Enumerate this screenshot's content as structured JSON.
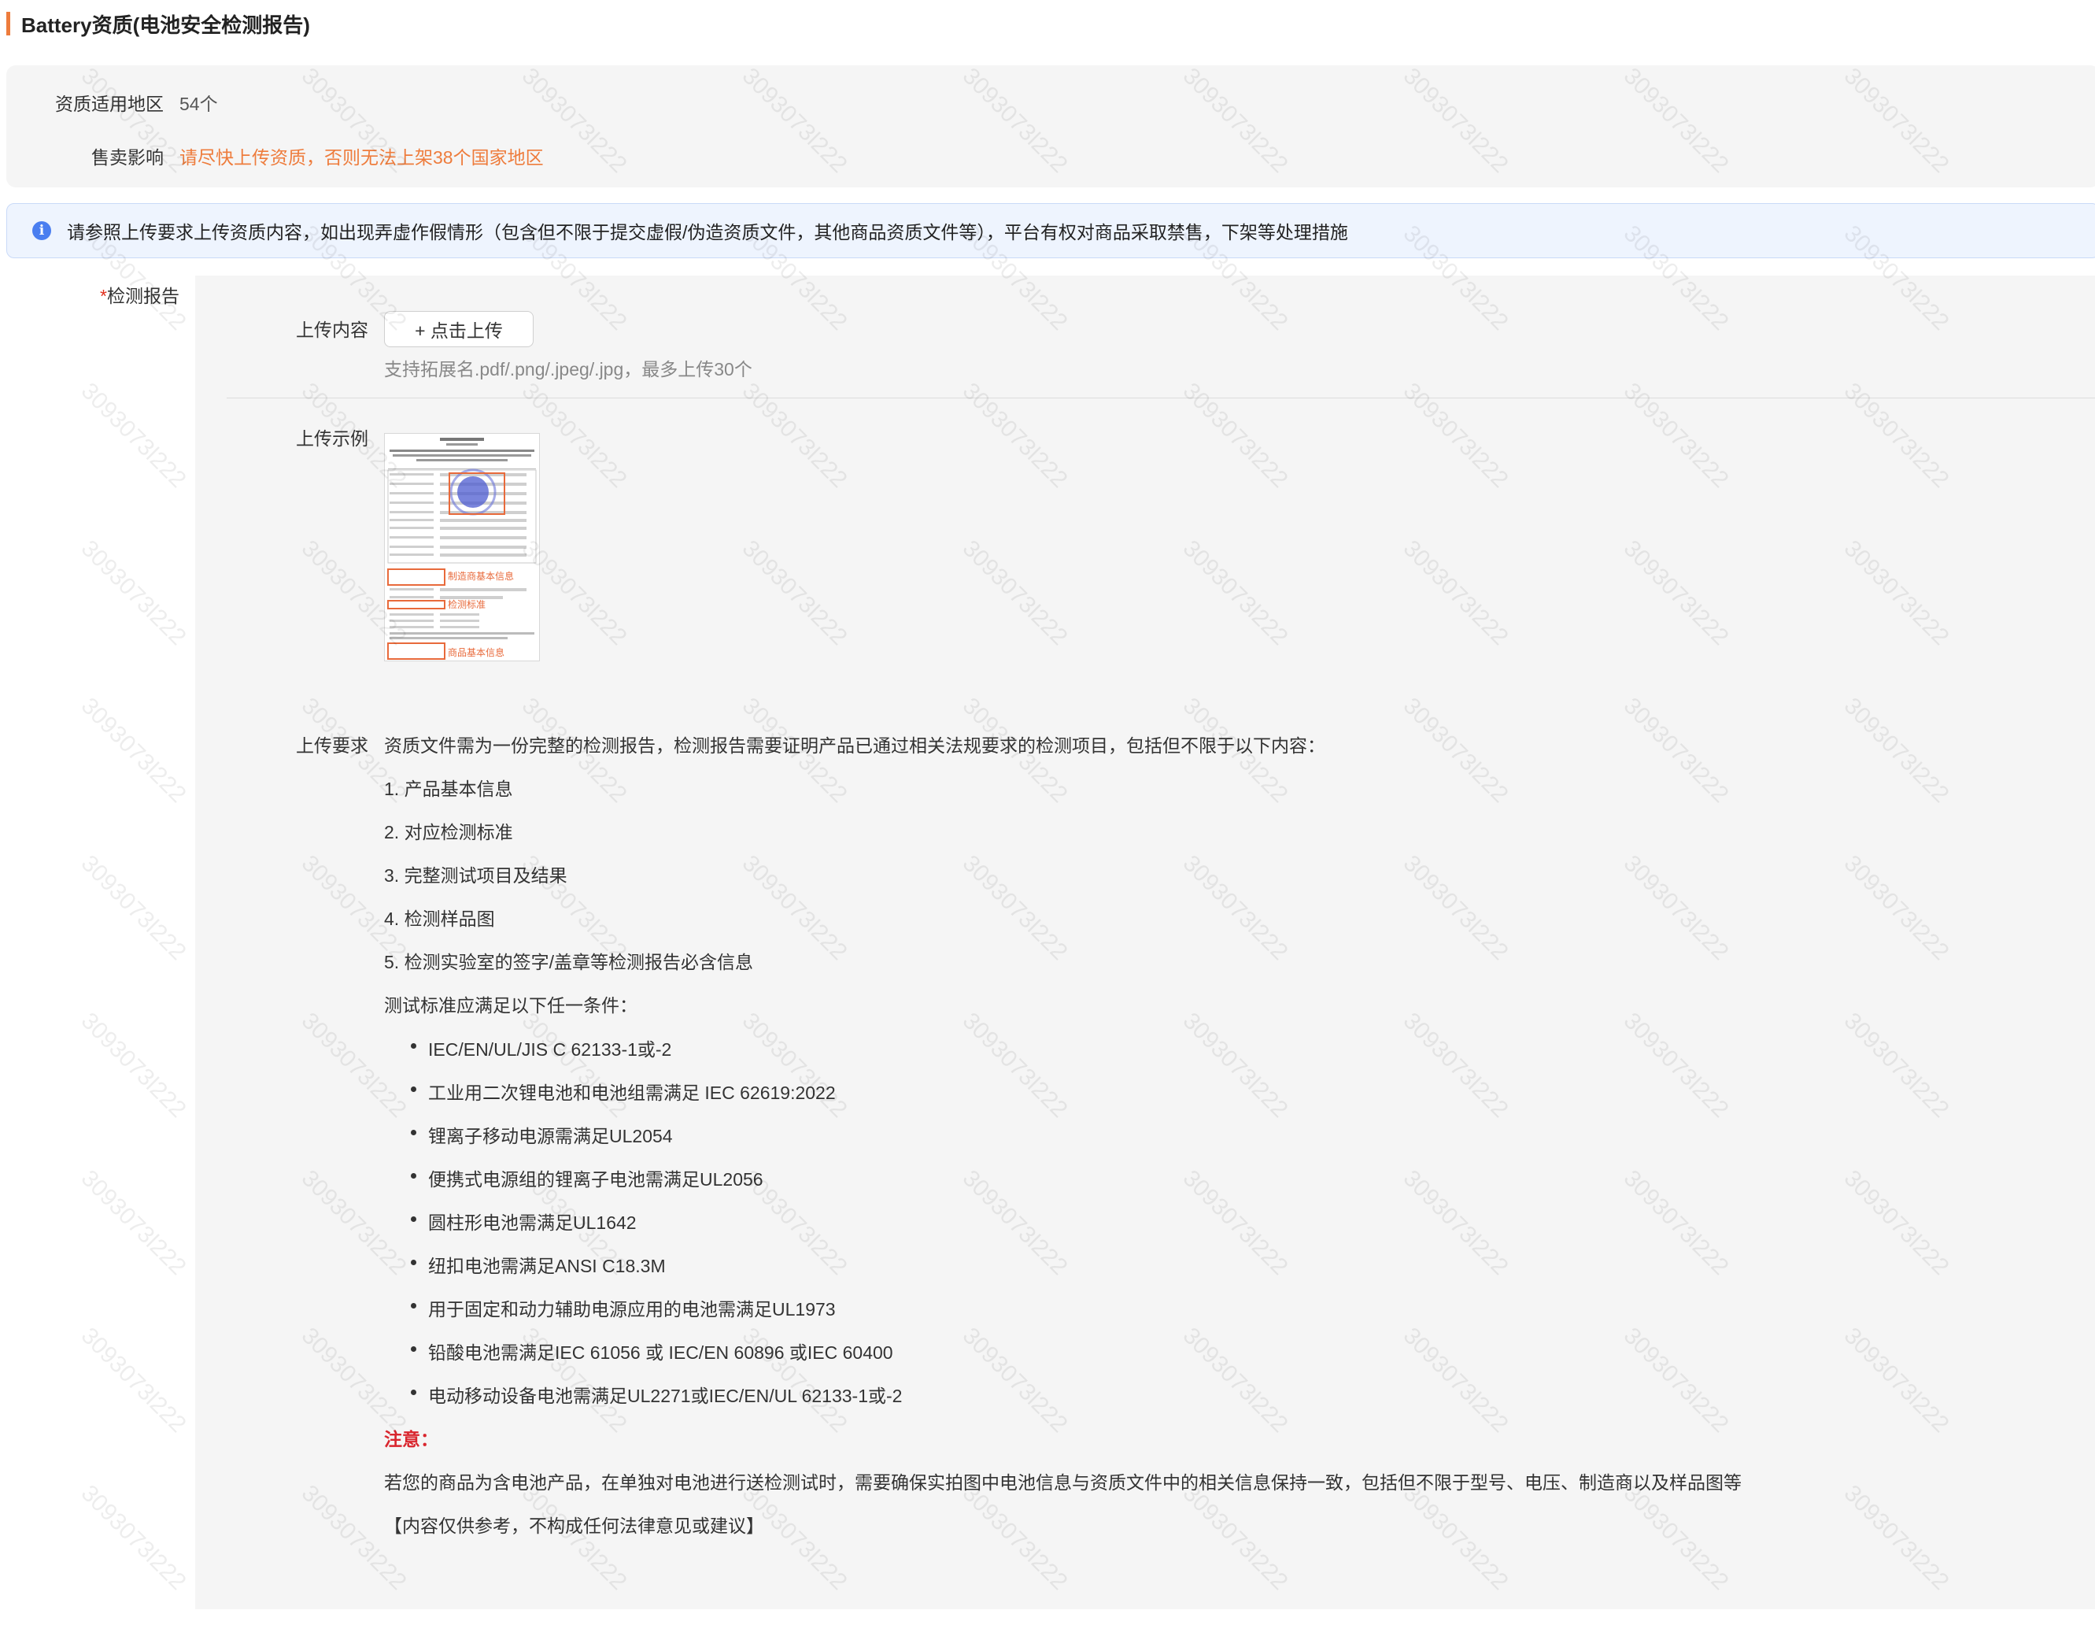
{
  "section": {
    "title": "Battery资质(电池安全检测报告)",
    "accent_color": "#ee7c3c"
  },
  "info": {
    "region_label": "资质适用地区",
    "region_value": "54个",
    "impact_label": "售卖影响",
    "impact_value": "请尽快上传资质，否则无法上架38个国家地区"
  },
  "notice": {
    "icon": "info-icon",
    "text": "请参照上传要求上传资质内容，如出现弄虚作假情形（包含但不限于提交虚假/伪造资质文件，其他商品资质文件等），平台有权对商品采取禁售，下架等处理措施"
  },
  "field": {
    "required_mark": "*",
    "label": "检测报告",
    "upload_label": "上传内容",
    "upload_button": "+ 点击上传",
    "upload_hint": "支持拓展名.pdf/.png/.jpeg/.jpg，最多上传30个",
    "example_label": "上传示例",
    "example_annotations": [
      "制造商基本信息",
      "检测标准",
      "商品基本信息"
    ],
    "requirements_label": "上传要求",
    "requirements_intro": "资质文件需为一份完整的检测报告，检测报告需要证明产品已通过相关法规要求的检测项目，包括但不限于以下内容：",
    "requirements_items": [
      "1. 产品基本信息",
      "2. 对应检测标准",
      "3. 完整测试项目及结果",
      "4. 检测样品图",
      "5. 检测实验室的签字/盖章等检测报告必含信息"
    ],
    "standards_intro": "测试标准应满足以下任一条件：",
    "standards": [
      "IEC/EN/UL/JIS C 62133-1或-2",
      "工业用二次锂电池和电池组需满足 IEC 62619:2022",
      "锂离子移动电源需满足UL2054",
      "便携式电源组的锂离子电池需满足UL2056",
      "圆柱形电池需满足UL1642",
      "纽扣电池需满足ANSI C18.3M",
      "用于固定和动力辅助电源应用的电池需满足UL1973",
      "铅酸电池需满足IEC 61056 或 IEC/EN 60896 或IEC 60400",
      "电动移动设备电池需满足UL2271或IEC/EN/UL 62133-1或-2"
    ],
    "note_title": "注意：",
    "note_text": "若您的商品为含电池产品，在单独对电池进行送检测试时，需要确保实拍图中电池信息与资质文件中的相关信息保持一致，包括但不限于型号、电压、制造商以及样品图等",
    "disclaimer": "【内容仅供参考，不构成任何法律意见或建议】"
  },
  "watermark": "3093073l222"
}
